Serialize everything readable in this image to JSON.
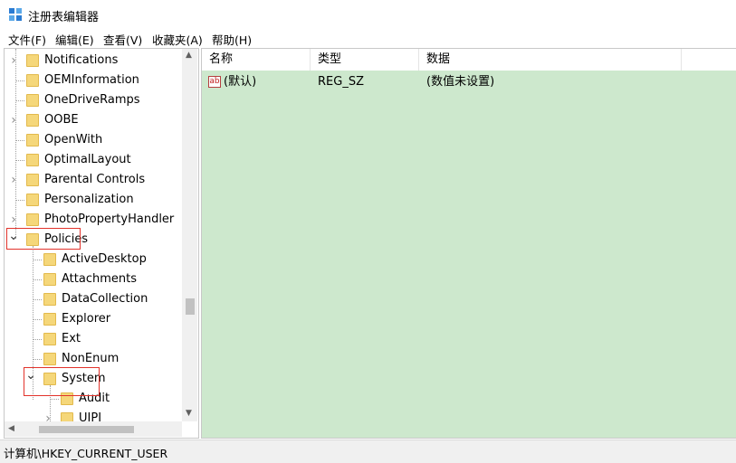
{
  "window": {
    "title": "注册表编辑器",
    "app_icon": "regedit-icon"
  },
  "menu": [
    "文件(F)",
    "编辑(E)",
    "查看(V)",
    "收藏夹(A)",
    "帮助(H)"
  ],
  "tree": {
    "items": [
      {
        "label": "Notifications",
        "expander": "collapsed"
      },
      {
        "label": "OEMInformation",
        "expander": "none"
      },
      {
        "label": "OneDriveRamps",
        "expander": "none"
      },
      {
        "label": "OOBE",
        "expander": "collapsed"
      },
      {
        "label": "OpenWith",
        "expander": "none"
      },
      {
        "label": "OptimalLayout",
        "expander": "none"
      },
      {
        "label": "Parental Controls",
        "expander": "collapsed"
      },
      {
        "label": "Personalization",
        "expander": "none"
      },
      {
        "label": "PhotoPropertyHandler",
        "expander": "collapsed"
      },
      {
        "label": "Policies",
        "expander": "expanded",
        "highlighted": true
      },
      {
        "label": "ActiveDesktop",
        "expander": "none"
      },
      {
        "label": "Attachments",
        "expander": "none"
      },
      {
        "label": "DataCollection",
        "expander": "none"
      },
      {
        "label": "Explorer",
        "expander": "none"
      },
      {
        "label": "Ext",
        "expander": "none"
      },
      {
        "label": "NonEnum",
        "expander": "none"
      },
      {
        "label": "System",
        "expander": "expanded",
        "highlighted": true
      },
      {
        "label": "Audit",
        "expander": "none"
      },
      {
        "label": "UIPI",
        "expander": "collapsed"
      }
    ]
  },
  "list": {
    "columns": [
      "名称",
      "类型",
      "数据"
    ],
    "rows": [
      {
        "icon": "string-value-icon",
        "name": "(默认)",
        "type": "REG_SZ",
        "data": "(数值未设置)"
      }
    ],
    "background": "#cde8cd"
  },
  "status": {
    "path": "计算机\\HKEY_CURRENT_USER"
  },
  "colors": {
    "highlight_border": "#e2332b",
    "folder": "#f5d77a"
  }
}
